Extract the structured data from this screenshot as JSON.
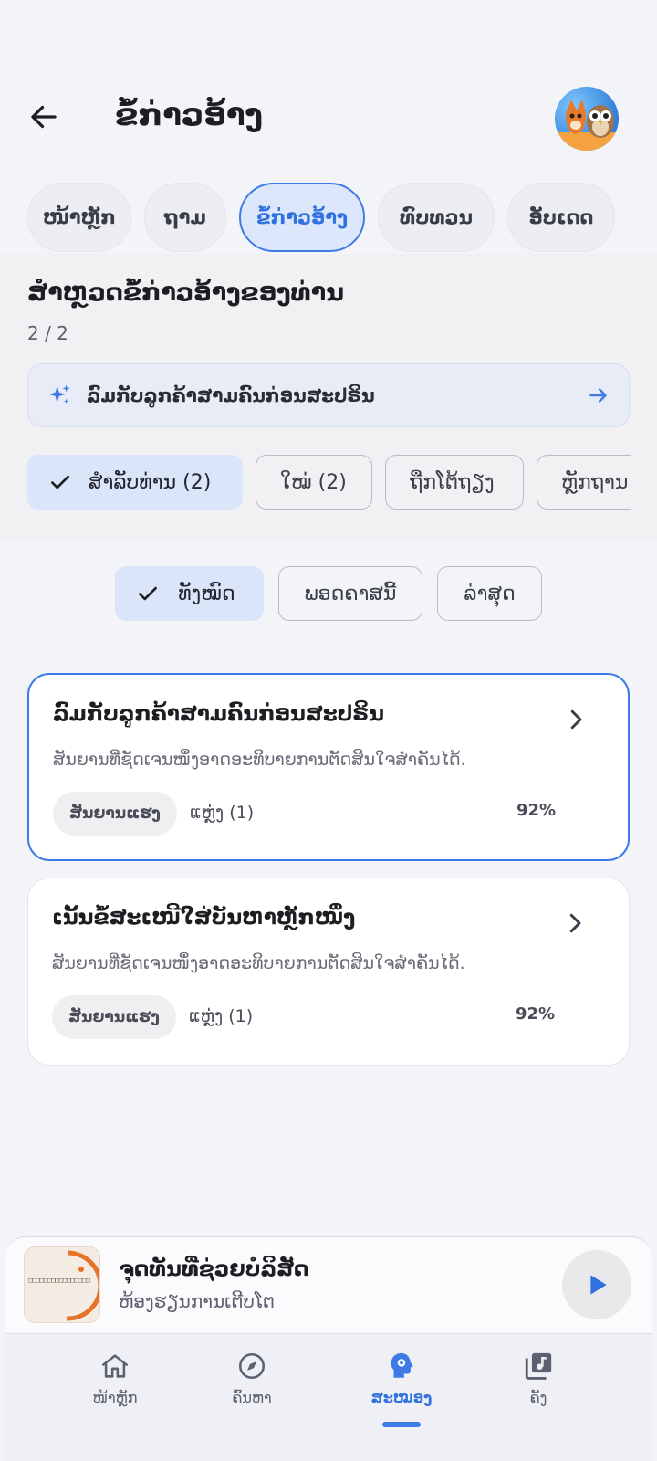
{
  "header": {
    "title": "ຂໍ້ກ່າວອ້າງ",
    "back_icon": "arrow-left-icon",
    "avatar_icon": "fox-owl-avatar"
  },
  "tabs": [
    {
      "label": "ໜ້າຫຼັກ",
      "active": false
    },
    {
      "label": "ຖາມ",
      "active": false
    },
    {
      "label": "ຂໍ້ກ່າວອ້າງ",
      "active": true
    },
    {
      "label": "ທົບທວນ",
      "active": false
    },
    {
      "label": "ອັບເດດ",
      "active": false
    }
  ],
  "section": {
    "title": "ສຳຫຼວດຂໍ້ກ່າວອ້າງຂອງທ່ານ",
    "count": "2 / 2"
  },
  "suggestion": {
    "text": "ລົມກັບລູກຄ້າສາມຄົນກ່ອນສະປຣິນ",
    "icon": "sparkle-icon",
    "arrow_icon": "arrow-right-icon"
  },
  "filters": [
    {
      "label": "ສຳລັບທ່ານ (2)",
      "selected": true
    },
    {
      "label": "ໃໝ່ (2)",
      "selected": false
    },
    {
      "label": "ຖືກໂຕ້ຖຽງ",
      "selected": false
    },
    {
      "label": "ຫຼັກຖານ",
      "selected": false
    }
  ],
  "sort": [
    {
      "label": "ທັງໝົດ",
      "selected": true
    },
    {
      "label": "ພອດຄາສນີ້",
      "selected": false
    },
    {
      "label": "ລ່າສຸດ",
      "selected": false
    }
  ],
  "cards": [
    {
      "title": "ລົມກັບລູກຄ້າສາມຄົນກ່ອນສະປຣິນ",
      "desc": "ສັນຍານທີ່ຊັດເຈນໜຶ່ງອາດອະທິບາຍການຕັດສິນໃຈສຳຄັນໄດ້.",
      "badge": "ສັນຍານແຮງ",
      "places": "ແຫຼ່ງ (1)",
      "pct": "92%"
    },
    {
      "title": "ເນັ້ນຂໍ້ສະເໜີໃສ່ບັນຫາຫຼັກໜຶ່ງ",
      "desc": "ສັນຍານທີ່ຊັດເຈນໜຶ່ງອາດອະທິບາຍການຕັດສິນໃຈສຳຄັນໄດ້.",
      "badge": "ສັນຍານແຮງ",
      "places": "ແຫຼ່ງ (1)",
      "pct": "92%"
    }
  ],
  "player": {
    "title": "ຈຸດທັນທີ່ຊ່ວຍບໍລິສັດ",
    "subtitle": "ຫ້ອງຮຽນການເຕີບໂຕ",
    "play_icon": "play-icon",
    "thumb_text": "□□□□□□□□□□□□□□□□"
  },
  "nav": [
    {
      "label": "ໜ້າຫຼັກ",
      "icon": "home-icon",
      "active": false
    },
    {
      "label": "ຄົ້ນຫາ",
      "icon": "compass-icon",
      "active": false
    },
    {
      "label": "ສະໝອງ",
      "icon": "brain-head-icon",
      "active": true
    },
    {
      "label": "ຄັງ",
      "icon": "library-music-icon",
      "active": false
    }
  ],
  "colors": {
    "accent": "#3f7be6",
    "background": "#f3f4f8",
    "chip_selected": "#dbe5f9"
  }
}
